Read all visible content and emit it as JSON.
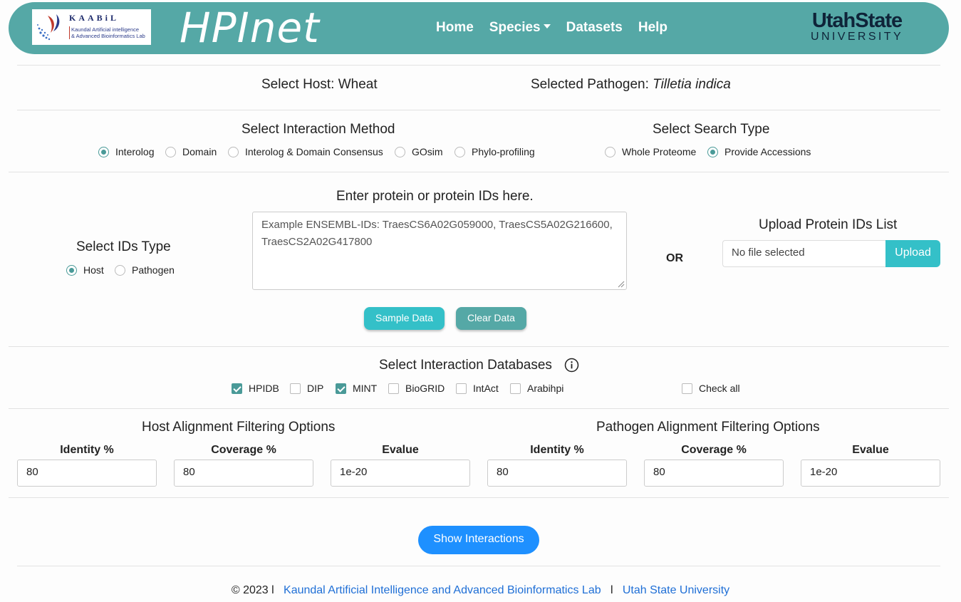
{
  "header": {
    "logo_title": "KAABiL",
    "logo_subtitle_1": "Kaundal Artificial intelligence",
    "logo_subtitle_2": "& Advanced Bioinformatics Lab",
    "brand": "HPInet",
    "nav": {
      "home": "Home",
      "species": "Species",
      "datasets": "Datasets",
      "help": "Help"
    },
    "university_top": "UtahState",
    "university_bottom": "UNIVERSITY"
  },
  "selection": {
    "host_label": "Select Host: Wheat",
    "pathogen_prefix": "Selected Pathogen: ",
    "pathogen_name": "Tilletia indica"
  },
  "interaction_method": {
    "title": "Select Interaction Method",
    "options": [
      "Interolog",
      "Domain",
      "Interolog & Domain Consensus",
      "GOsim",
      "Phylo-profiling"
    ],
    "selected": "Interolog"
  },
  "search_type": {
    "title": "Select Search Type",
    "options": [
      "Whole Proteome",
      "Provide Accessions"
    ],
    "selected": "Provide Accessions"
  },
  "ids_type": {
    "title": "Select IDs Type",
    "options": [
      "Host",
      "Pathogen"
    ],
    "selected": "Host"
  },
  "protein_input": {
    "title": "Enter protein or protein IDs here.",
    "placeholder": "Example ENSEMBL-IDs: TraesCS6A02G059000, TraesCS5A02G216600, TraesCS2A02G417800",
    "or_label": "OR"
  },
  "upload": {
    "title": "Upload Protein IDs List",
    "file_text": "No file selected",
    "button": "Upload"
  },
  "buttons": {
    "sample": "Sample Data",
    "clear": "Clear Data",
    "show": "Show Interactions"
  },
  "databases": {
    "title": "Select Interaction Databases",
    "items": [
      {
        "label": "HPIDB",
        "checked": true
      },
      {
        "label": "DIP",
        "checked": false
      },
      {
        "label": "MINT",
        "checked": true
      },
      {
        "label": "BioGRID",
        "checked": false
      },
      {
        "label": "IntAct",
        "checked": false
      },
      {
        "label": "Arabihpi",
        "checked": false
      }
    ],
    "check_all": "Check all"
  },
  "host_filter": {
    "title": "Host Alignment Filtering Options",
    "identity_label": "Identity %",
    "identity": "80",
    "coverage_label": "Coverage %",
    "coverage": "80",
    "evalue_label": "Evalue",
    "evalue": "1e-20"
  },
  "pathogen_filter": {
    "title": "Pathogen Alignment Filtering Options",
    "identity_label": "Identity %",
    "identity": "80",
    "coverage_label": "Coverage %",
    "coverage": "80",
    "evalue_label": "Evalue",
    "evalue": "1e-20"
  },
  "footer": {
    "copyright": "© 2023 l",
    "lab_link": "Kaundal Artificial Intelligence and Advanced Bioinformatics Lab",
    "separator": "l",
    "university_link": "Utah State University"
  },
  "colors": {
    "teal": "#55a8a6",
    "cyan": "#34c0c8",
    "blue": "#1e90ff",
    "usu_navy": "#0f2439"
  }
}
